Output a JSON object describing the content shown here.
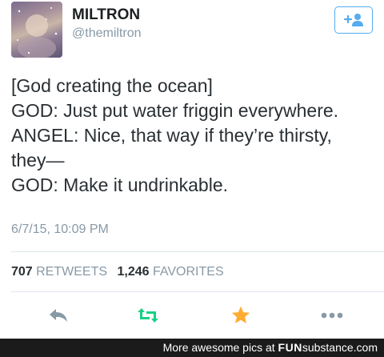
{
  "tweet": {
    "display_name": "MILTRON",
    "handle": "@themiltron",
    "lines": [
      "[God creating the ocean]",
      "GOD: Just put water friggin everywhere.",
      "ANGEL: Nice, that way if they’re thirsty,",
      "they—",
      "GOD: Make it undrinkable."
    ],
    "timestamp": "6/7/15, 10:09 PM",
    "retweets_count": "707",
    "retweets_label": "RETWEETS",
    "favorites_count": "1,246",
    "favorites_label": "FAVORITES"
  },
  "icons": {
    "follow": "follow-add-user-icon",
    "reply": "reply-icon",
    "retweet": "retweet-icon",
    "favorite": "favorite-star-icon",
    "more": "more-dots-icon"
  },
  "colors": {
    "brand_blue": "#55acee",
    "retweet_green": "#19cf86",
    "favorite_gold": "#ffac33",
    "muted_grey": "#8899a6",
    "footer_bg": "#1b1b1b"
  },
  "footer": {
    "text": "More awesome pics at ",
    "brand_fun": "FUN",
    "brand_sub": "substance",
    "brand_domain": ".com"
  }
}
